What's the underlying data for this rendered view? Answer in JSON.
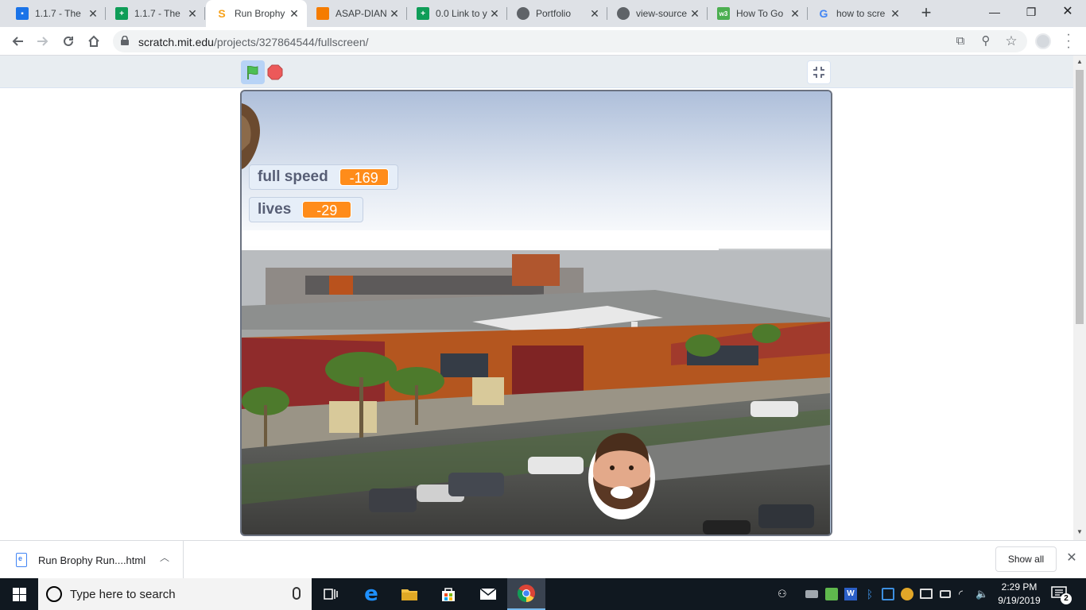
{
  "browser": {
    "tabs": [
      {
        "title": "1.1.7 - The",
        "icon": "google-classroom-icon",
        "color": "#1a73e8"
      },
      {
        "title": "1.1.7 - The",
        "icon": "google-sheets-icon",
        "color": "#0f9d58"
      },
      {
        "title": "Run Brophy",
        "icon": "scratch-icon",
        "color": "#f7a21b",
        "active": true
      },
      {
        "title": "ASAP-DIAN",
        "icon": "asap-cube-icon",
        "color": "#f57c00"
      },
      {
        "title": "0.0 Link to y",
        "icon": "google-sheets-icon",
        "color": "#0f9d58"
      },
      {
        "title": "Portfolio",
        "icon": "globe-icon",
        "color": "#5f6368"
      },
      {
        "title": "view-source",
        "icon": "globe-icon",
        "color": "#5f6368"
      },
      {
        "title": "How To Go",
        "icon": "w3schools-icon",
        "color": "#4caf50"
      },
      {
        "title": "how to scre",
        "icon": "google-icon",
        "color": "#4285f4"
      }
    ],
    "url_host": "scratch.mit.edu",
    "url_path": "/projects/327864544/fullscreen/"
  },
  "scratch": {
    "monitors": [
      {
        "label": "full speed",
        "value": "-169"
      },
      {
        "label": "lives",
        "value": "-29"
      }
    ]
  },
  "downloads": {
    "file_name": "Run Brophy Run....html",
    "show_all_label": "Show all"
  },
  "taskbar": {
    "search_placeholder": "Type here to search",
    "time": "2:29 PM",
    "date": "9/19/2019",
    "notification_count": "2"
  }
}
